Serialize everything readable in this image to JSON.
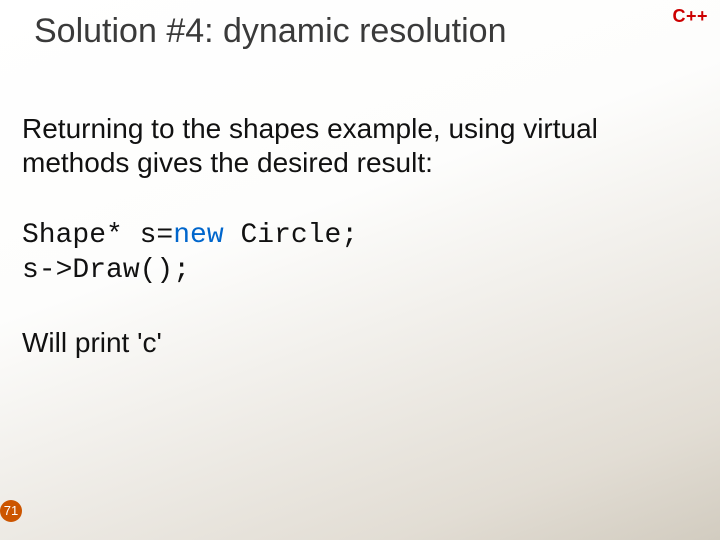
{
  "badge": "C++",
  "title": "Solution #4: dynamic resolution",
  "body": {
    "intro": "Returning to the shapes example, using virtual methods gives the desired result:",
    "code_part1": "Shape* s=",
    "code_kw": "new",
    "code_part2": " Circle;",
    "code_line2": "s->Draw();",
    "outro": "Will print 'c'"
  },
  "page_number": "71"
}
